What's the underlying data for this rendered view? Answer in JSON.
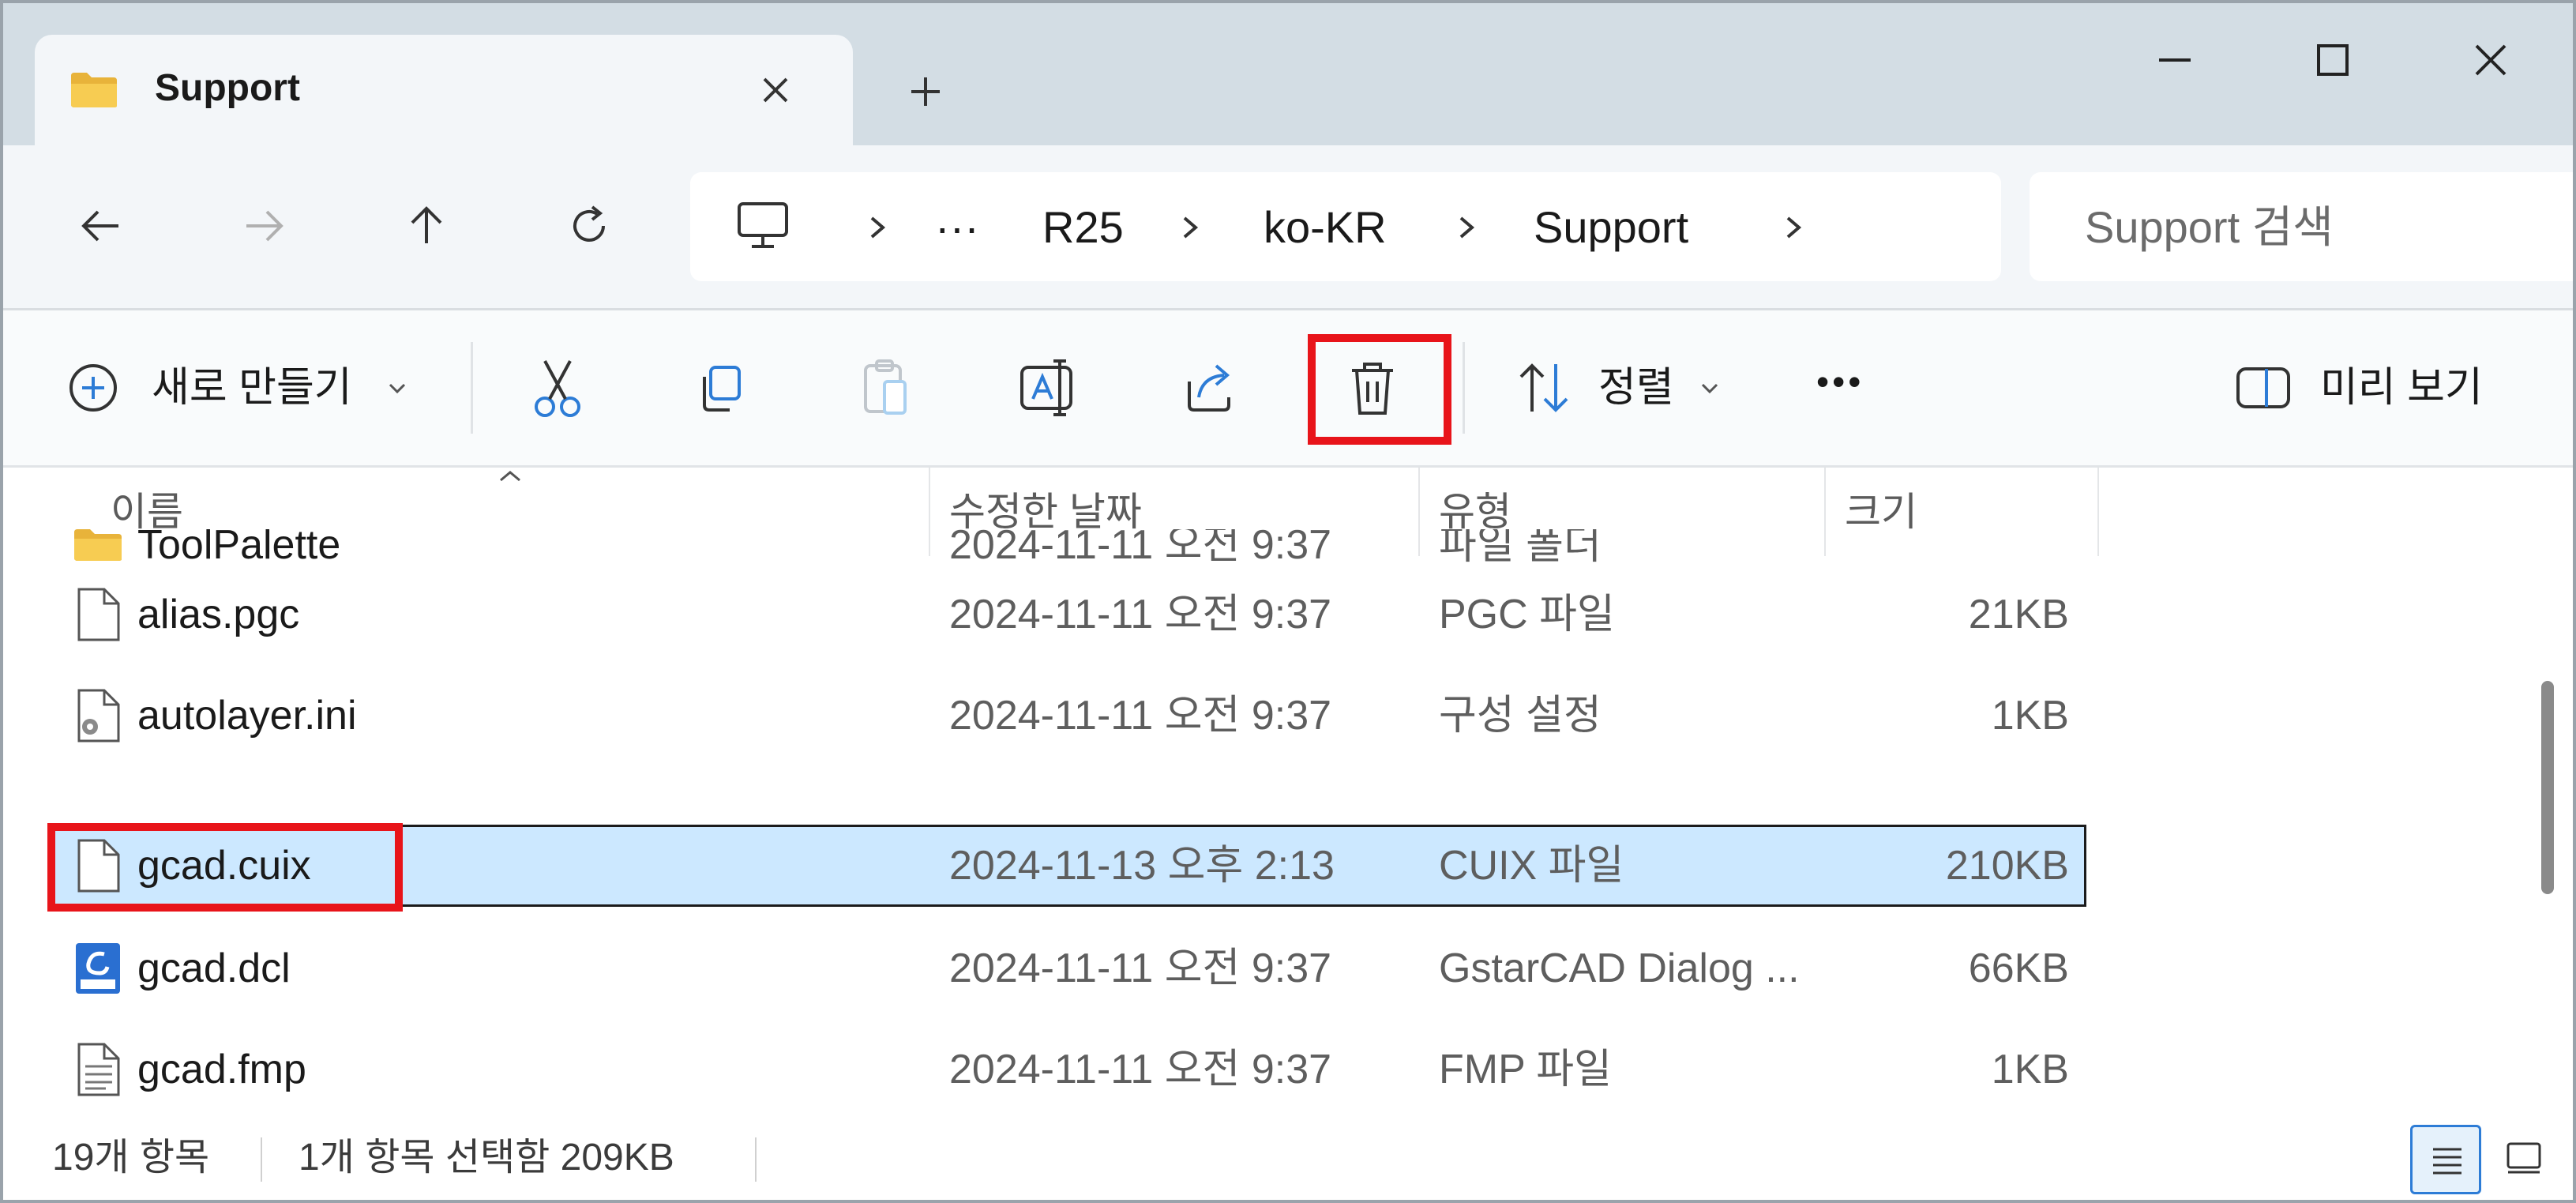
{
  "tab": {
    "title": "Support",
    "close_icon": "close-icon",
    "new_tab_icon": "plus-icon"
  },
  "window_controls": {
    "minimize": "minimize-icon",
    "maximize": "maximize-icon",
    "close": "close-icon"
  },
  "nav": {
    "back": "arrow-left-icon",
    "forward": "arrow-right-icon",
    "up": "arrow-up-icon",
    "refresh": "refresh-icon"
  },
  "address": {
    "root_icon": "computer-icon",
    "ellipsis": "···",
    "crumbs": [
      "R25",
      "ko-KR",
      "Support"
    ]
  },
  "search": {
    "placeholder": "Support 검색"
  },
  "toolbar": {
    "new_label": "새로 만들기",
    "sort_label": "정렬",
    "preview_label": "미리 보기",
    "more": "•••"
  },
  "columns": {
    "name": "이름",
    "modified": "수정한 날짜",
    "type": "유형",
    "size": "크기"
  },
  "files": [
    {
      "name": "ToolPalette",
      "date": "2024-11-11 오전 9:37",
      "type": "파일 폴더",
      "size": "",
      "icon": "folder-icon"
    },
    {
      "name": "alias.pgc",
      "date": "2024-11-11 오전 9:37",
      "type": "PGC 파일",
      "size": "21KB",
      "icon": "file-icon"
    },
    {
      "name": "autolayer.ini",
      "date": "2024-11-11 오전 9:37",
      "type": "구성 설정",
      "size": "1KB",
      "icon": "settings-file-icon"
    },
    {
      "name": "gcad.cuix",
      "date": "2024-11-13 오후 2:13",
      "type": "CUIX 파일",
      "size": "210KB",
      "icon": "file-icon"
    },
    {
      "name": "gcad.dcl",
      "date": "2024-11-11 오전 9:37",
      "type": "GstarCAD Dialog ...",
      "size": "66KB",
      "icon": "dcl-file-icon"
    },
    {
      "name": "gcad.fmp",
      "date": "2024-11-11 오전 9:37",
      "type": "FMP 파일",
      "size": "1KB",
      "icon": "text-file-icon"
    }
  ],
  "status": {
    "count": "19개 항목",
    "selection": "1개 항목 선택함 209KB"
  },
  "colors": {
    "selection": "#cce8ff",
    "highlight": "#e8141a",
    "accent": "#2d7cd6"
  }
}
